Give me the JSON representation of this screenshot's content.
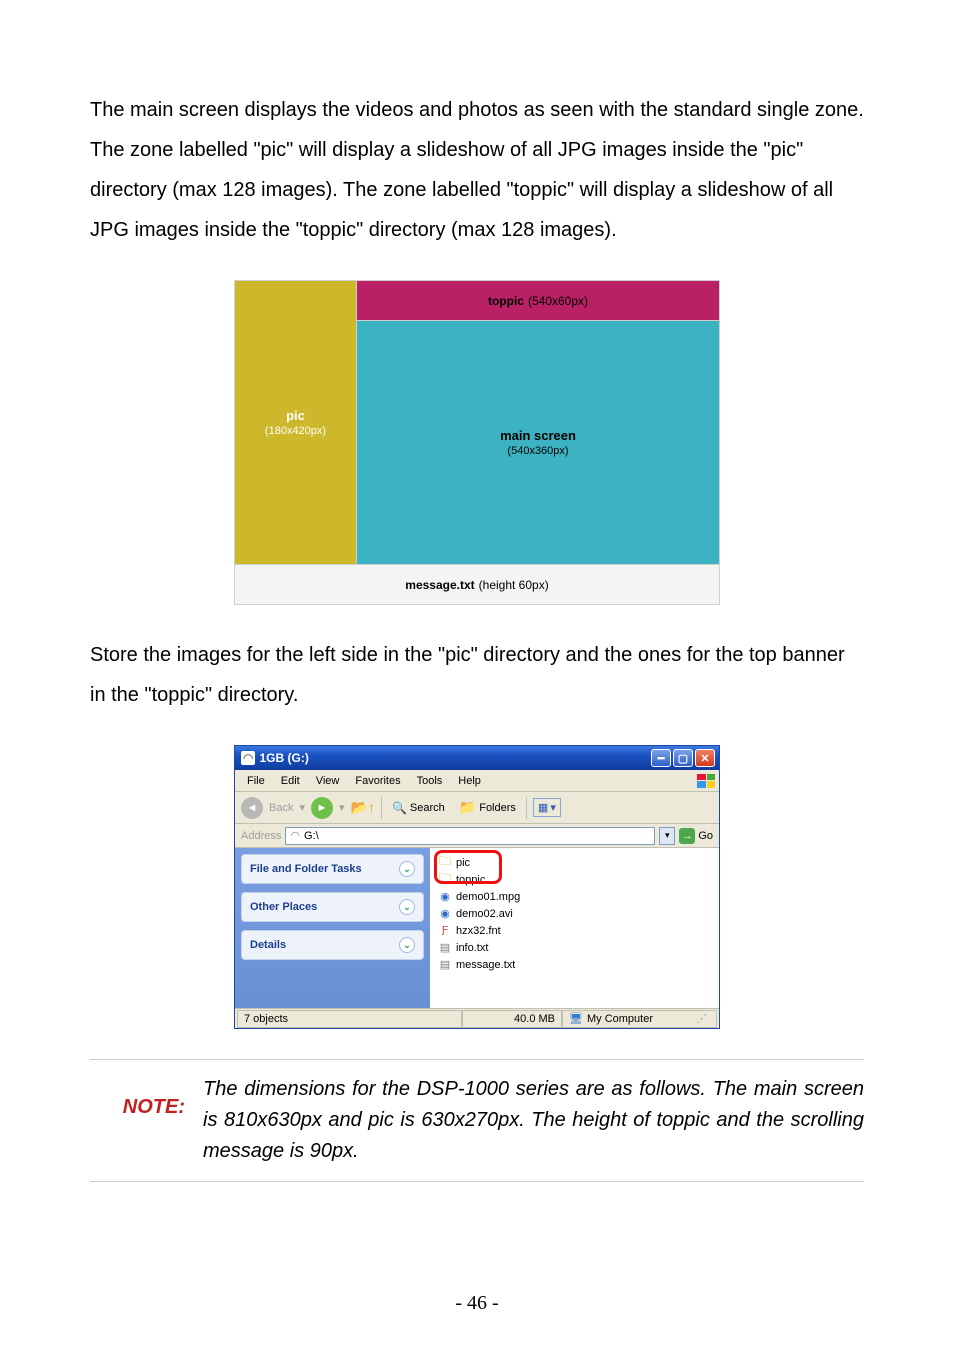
{
  "paragraphs": {
    "intro": "The main screen displays the videos and photos as seen with the standard single zone. The zone labelled \"pic\" will display a slideshow of all JPG images inside the \"pic\" directory (max 128 images). The zone labelled \"toppic\" will display a slideshow of all JPG images inside the \"toppic\" directory (max 128 images).",
    "store": "Store the images for the left side in the \"pic\" directory and the ones for the top banner in the \"toppic\" directory."
  },
  "layout": {
    "pic": {
      "label": "pic",
      "dim": "(180x420px)"
    },
    "toppic": {
      "label": "toppic",
      "dim": "(540x60px)"
    },
    "main": {
      "label": "main screen",
      "dim": "(540x360px)"
    },
    "message": {
      "label": "message.txt",
      "dim": "(height 60px)"
    }
  },
  "explorer": {
    "title": "1GB (G:)",
    "menus": {
      "file": "File",
      "edit": "Edit",
      "view": "View",
      "favorites": "Favorites",
      "tools": "Tools",
      "help": "Help"
    },
    "toolbar": {
      "back": "Back",
      "search": "Search",
      "folders": "Folders"
    },
    "address": {
      "label": "Address",
      "value": "G:\\",
      "go": "Go"
    },
    "tasks": {
      "fileTasks": "File and Folder Tasks",
      "otherPlaces": "Other Places",
      "details": "Details"
    },
    "files": {
      "f0": "pic",
      "f1": "toppic",
      "f2": "demo01.mpg",
      "f3": "demo02.avi",
      "f4": "hzx32.fnt",
      "f5": "info.txt",
      "f6": "message.txt"
    },
    "status": {
      "objects": "7 objects",
      "size": "40.0 MB",
      "location": "My Computer"
    }
  },
  "note": {
    "label": "NOTE:",
    "text": "The dimensions for the DSP-1000 series are as follows. The main screen is 810x630px and pic is 630x270px. The height of toppic and the scrolling message is 90px."
  },
  "pageNumber": "- 46 -"
}
